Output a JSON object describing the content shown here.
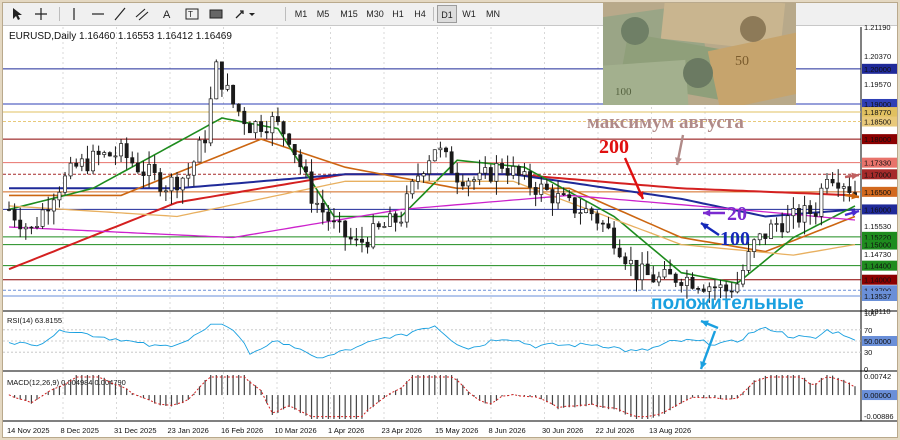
{
  "toolbar": {
    "tools": [
      "cursor",
      "crosshair",
      "vertical-line",
      "horizontal-line",
      "trendline",
      "channel",
      "text",
      "label",
      "shapes",
      "arrow"
    ],
    "timeframes": [
      "M1",
      "M5",
      "M15",
      "M30",
      "H1",
      "H4",
      "D1",
      "W1",
      "MN"
    ],
    "active_timeframe": "D1"
  },
  "chart_header": "EURUSD,Daily  1.16460 1.16553 1.16412 1.16469",
  "annotations": {
    "max_august": "максимум августа",
    "ma200": "200",
    "ma20": "20",
    "ma100": "100",
    "positive": "положительные"
  },
  "price_labels": [
    {
      "v": "1.21190",
      "bg": "",
      "fg": "#000000"
    },
    {
      "v": "1.20370",
      "bg": "",
      "fg": "#000000"
    },
    {
      "v": "1.20000",
      "bg": "#1f2a99",
      "fg": "#ffffff"
    },
    {
      "v": "1.19570",
      "bg": "",
      "fg": "#000000"
    },
    {
      "v": "1.19000",
      "bg": "#2e3fb5",
      "fg": "#ffffff"
    },
    {
      "v": "1.18770",
      "bg": "#e0c060",
      "fg": "#ffffff"
    },
    {
      "v": "1.18500",
      "bg": "#e8c97a",
      "fg": "#ffffff"
    },
    {
      "v": "1.18000",
      "bg": "#8b0000",
      "fg": "#ffffff"
    },
    {
      "v": "1.17330",
      "bg": "#e8736b",
      "fg": "#ffffff"
    },
    {
      "v": "1.17000",
      "bg": "#a52a2a",
      "fg": "#ffffff"
    },
    {
      "v": "1.16500",
      "bg": "#d2691e",
      "fg": "#ffffff"
    },
    {
      "v": "1.16000",
      "bg": "#1f2a99",
      "fg": "#ffffff"
    },
    {
      "v": "1.15530",
      "bg": "",
      "fg": "#000000"
    },
    {
      "v": "1.15220",
      "bg": "#1e8c1e",
      "fg": "#ffffff"
    },
    {
      "v": "1.15000",
      "bg": "#1e8c1e",
      "fg": "#ffffff"
    },
    {
      "v": "1.14730",
      "bg": "",
      "fg": "#000000"
    },
    {
      "v": "1.14400",
      "bg": "#1e8c1e",
      "fg": "#ffffff"
    },
    {
      "v": "1.14000",
      "bg": "#8b0000",
      "fg": "#ffffff"
    },
    {
      "v": "1.13700",
      "bg": "#6a8fd8",
      "fg": "#ffffff"
    },
    {
      "v": "1.13537",
      "bg": "#6a8fd8",
      "fg": "#ffffff"
    },
    {
      "v": "1.13110",
      "bg": "",
      "fg": "#000000"
    }
  ],
  "date_labels": [
    "14 Nov 2025",
    "8 Dec 2025",
    "31 Dec 2025",
    "23 Jan 2026",
    "16 Feb 2026",
    "10 Mar 2026",
    "1 Apr 2026",
    "23 Apr 2026",
    "15 May 2026",
    "8 Jun 2026",
    "30 Jun 2026",
    "22 Jul 2026",
    "13 Aug 2026"
  ],
  "rsi": {
    "label": "RSI(14) 63.8155",
    "levels": [
      "100",
      "70",
      "50.0000",
      "30",
      "0"
    ]
  },
  "macd": {
    "label": "MACD(12,26,9) 0.004984 0.004790",
    "levels": [
      "0.00742",
      "0.00000",
      "-0.00886"
    ]
  },
  "colors": {
    "candles": "#1a1a1a",
    "ma200": "#d42020",
    "ma100": "#1f2a99",
    "ma50": "#cc6611",
    "ma20": "#1e8c1e",
    "ma_extra": "#cc22cc",
    "ma_slow": "#e8b060",
    "annotation_red": "#e01010",
    "annotation_blue": "#1428b8",
    "annotation_purple": "#7a2ad0",
    "annotation_brown": "#b08a88",
    "annotation_cyan": "#1aa0e0"
  },
  "chart_data": {
    "type": "candlestick",
    "symbol": "EURUSD",
    "timeframe": "Daily",
    "header_values": {
      "open": 1.1646,
      "high": 1.16553,
      "low": 1.16412,
      "close": 1.16469
    },
    "ylim": [
      1.1311,
      1.2119
    ],
    "x_tick_labels": [
      "14 Nov 2025",
      "8 Dec 2025",
      "31 Dec 2025",
      "23 Jan 2026",
      "16 Feb 2026",
      "10 Mar 2026",
      "1 Apr 2026",
      "23 Apr 2026",
      "15 May 2026",
      "8 Jun 2026",
      "30 Jun 2026",
      "22 Jul 2026",
      "13 Aug 2026"
    ],
    "close_anchors": [
      [
        0,
        1.16
      ],
      [
        4,
        1.154
      ],
      [
        8,
        1.165
      ],
      [
        12,
        1.172
      ],
      [
        16,
        1.175
      ],
      [
        20,
        1.176
      ],
      [
        24,
        1.171
      ],
      [
        28,
        1.167
      ],
      [
        32,
        1.17
      ],
      [
        35,
        1.181
      ],
      [
        37,
        1.2
      ],
      [
        40,
        1.19
      ],
      [
        43,
        1.184
      ],
      [
        47,
        1.185
      ],
      [
        50,
        1.181
      ],
      [
        54,
        1.164
      ],
      [
        58,
        1.155
      ],
      [
        62,
        1.15
      ],
      [
        66,
        1.154
      ],
      [
        70,
        1.158
      ],
      [
        73,
        1.17
      ],
      [
        76,
        1.178
      ],
      [
        80,
        1.17
      ],
      [
        84,
        1.168
      ],
      [
        88,
        1.173
      ],
      [
        92,
        1.168
      ],
      [
        96,
        1.165
      ],
      [
        100,
        1.161
      ],
      [
        104,
        1.159
      ],
      [
        108,
        1.152
      ],
      [
        112,
        1.142
      ],
      [
        116,
        1.14
      ],
      [
        120,
        1.141
      ],
      [
        124,
        1.139
      ],
      [
        128,
        1.137
      ],
      [
        130,
        1.139
      ],
      [
        133,
        1.15
      ],
      [
        137,
        1.156
      ],
      [
        141,
        1.158
      ],
      [
        144,
        1.16
      ],
      [
        146,
        1.171
      ],
      [
        149,
        1.168
      ],
      [
        151,
        1.1647
      ]
    ],
    "moving_averages": [
      {
        "period": 200,
        "color": "#d42020",
        "points": [
          [
            0,
            1.143
          ],
          [
            30,
            1.162
          ],
          [
            60,
            1.17
          ],
          [
            90,
            1.17
          ],
          [
            120,
            1.166
          ],
          [
            151,
            1.164
          ]
        ]
      },
      {
        "period": 100,
        "color": "#1f2a99",
        "points": [
          [
            0,
            1.166
          ],
          [
            30,
            1.166
          ],
          [
            60,
            1.17
          ],
          [
            90,
            1.17
          ],
          [
            120,
            1.163
          ],
          [
            135,
            1.158
          ],
          [
            151,
            1.16
          ]
        ]
      },
      {
        "period": 50,
        "color": "#cc6611",
        "points": [
          [
            0,
            1.164
          ],
          [
            20,
            1.164
          ],
          [
            45,
            1.18
          ],
          [
            60,
            1.172
          ],
          [
            80,
            1.166
          ],
          [
            100,
            1.166
          ],
          [
            120,
            1.152
          ],
          [
            135,
            1.148
          ],
          [
            151,
            1.158
          ]
        ]
      },
      {
        "period": 20,
        "color": "#1e8c1e",
        "points": [
          [
            0,
            1.16
          ],
          [
            15,
            1.166
          ],
          [
            38,
            1.186
          ],
          [
            48,
            1.183
          ],
          [
            58,
            1.158
          ],
          [
            70,
            1.158
          ],
          [
            80,
            1.174
          ],
          [
            92,
            1.172
          ],
          [
            108,
            1.158
          ],
          [
            120,
            1.142
          ],
          [
            130,
            1.139
          ],
          [
            140,
            1.152
          ],
          [
            151,
            1.161
          ]
        ]
      }
    ],
    "rsi": {
      "period": 14,
      "last": 63.8155,
      "ylim": [
        0,
        100
      ],
      "levels": [
        70,
        50,
        30
      ]
    },
    "macd": {
      "params": [
        12,
        26,
        9
      ],
      "last_main": 0.004984,
      "last_signal": 0.00479,
      "ylim": [
        -0.00886,
        0.00742
      ]
    }
  }
}
